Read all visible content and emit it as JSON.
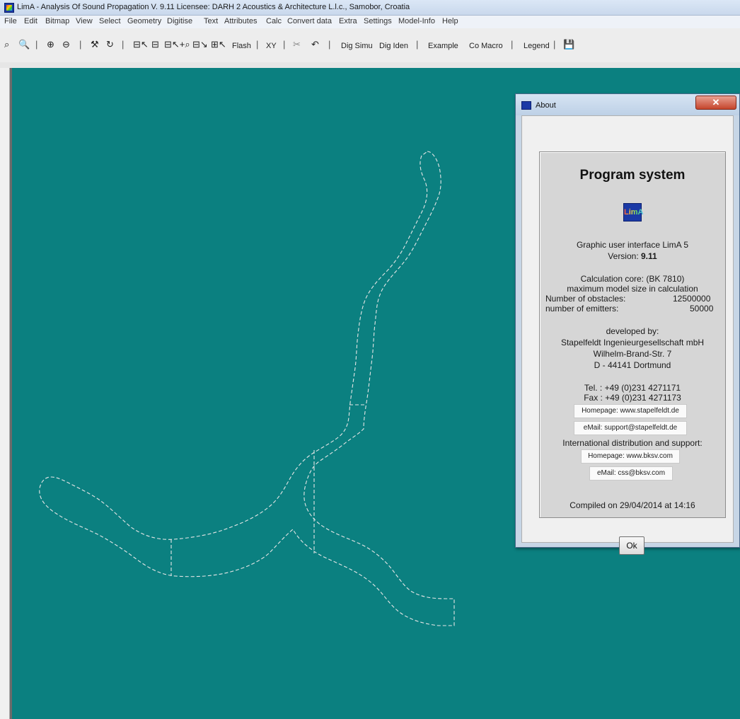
{
  "window": {
    "title": "LimA - Analysis Of Sound Propagation    V. 9.11    Licensee: DARH 2 Acoustics & Architecture L.l.c., Samobor, Croatia"
  },
  "menu": [
    "File",
    "Edit",
    "Bitmap",
    "View",
    "Select",
    "Geometry",
    "Digitise",
    "Text",
    "Attributes",
    "Calc",
    "Convert data",
    "Extra",
    "Settings",
    "Model-Info",
    "Help"
  ],
  "toolbar": {
    "zoom_fit_icon": "⌕",
    "zoom_icon": "🔍",
    "zoom_in_icon": "⊕",
    "zoom_out_icon": "⊖",
    "tools_icon": "⚒",
    "refresh_icon": "↻",
    "flash": "Flash",
    "xy": "XY",
    "dig_simu": "Dig Simu",
    "dig_iden": "Dig Iden",
    "example": "Example",
    "co_macro": "Co Macro",
    "legend": "Legend",
    "save_icon": "💾"
  },
  "about": {
    "title": "About",
    "close": "✕",
    "heading": "Program system",
    "logo": "LimA",
    "gui_line": "Graphic user interface LimA 5",
    "version_label": "Version:",
    "version_value": "9.11",
    "core_line": "Calculation core:  (BK 7810)",
    "max_model": "maximum model size in calculation",
    "obstacles_label": "Number of obstacles:",
    "obstacles_value": "12500000",
    "emitters_label": "number of emitters:",
    "emitters_value": "50000",
    "developed_by": "developed by:",
    "company": "Stapelfeldt Ingenieurgesellschaft mbH",
    "street": "Wilhelm-Brand-Str. 7",
    "city": "D - 44141 Dortmund",
    "tel": "Tel. : +49 (0)231 4271171",
    "fax": "Fax : +49 (0)231 4271173",
    "homepage1": "Homepage: www.stapelfeldt.de",
    "email1": "eMail: support@stapelfeldt.de",
    "intl": "International distribution and support:",
    "homepage2": "Homepage: www.bksv.com",
    "email2": "eMail: css@bksv.com",
    "compiled": "Compiled on 29/04/2014 at 14:16",
    "ok": "Ok"
  },
  "colors": {
    "canvas": "#0b8080",
    "outline": "#e6e6e6"
  }
}
